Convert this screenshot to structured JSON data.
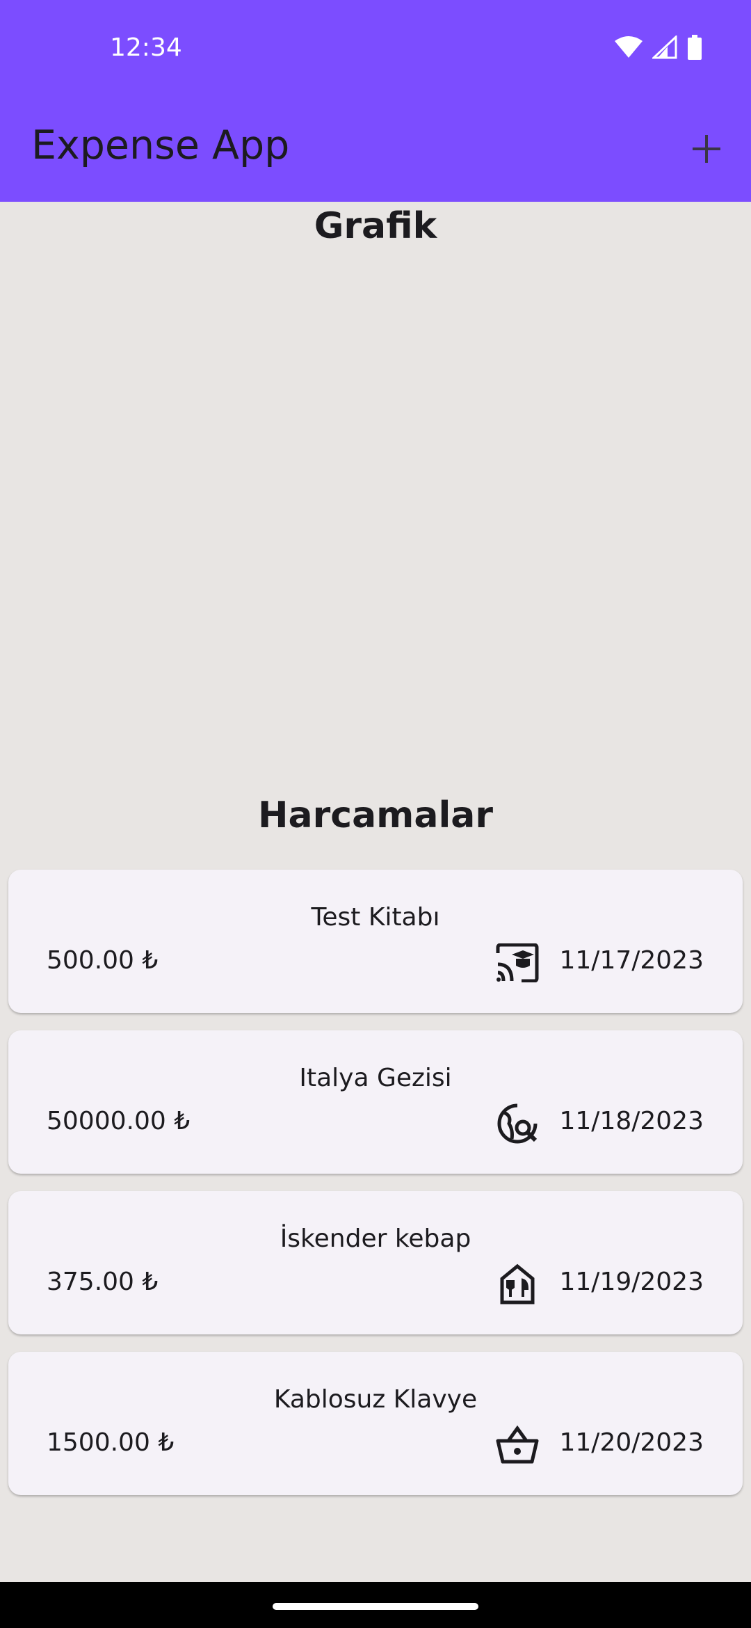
{
  "status_bar": {
    "time": "12:34"
  },
  "app_bar": {
    "title": "Expense App",
    "add_icon": "plus-icon"
  },
  "chart_section": {
    "title": "Grafik"
  },
  "expenses_section": {
    "title": "Harcamalar",
    "items": [
      {
        "title": "Test Kitabı",
        "amount": "500.00 ₺",
        "date": "11/17/2023",
        "icon": "cast-for-education-icon"
      },
      {
        "title": "Italya Gezisi",
        "amount": "50000.00 ₺",
        "date": "11/18/2023",
        "icon": "travel-explore-icon"
      },
      {
        "title": "İskender kebap",
        "amount": "375.00 ₺",
        "date": "11/19/2023",
        "icon": "restaurant-icon"
      },
      {
        "title": "Kablosuz Klavye",
        "amount": "1500.00 ₺",
        "date": "11/20/2023",
        "icon": "shopping-basket-icon"
      }
    ]
  },
  "colors": {
    "primary": "#7c4dff",
    "background": "#e8e5e3",
    "card": "#f5f2f8",
    "text": "#1c1b1f"
  }
}
